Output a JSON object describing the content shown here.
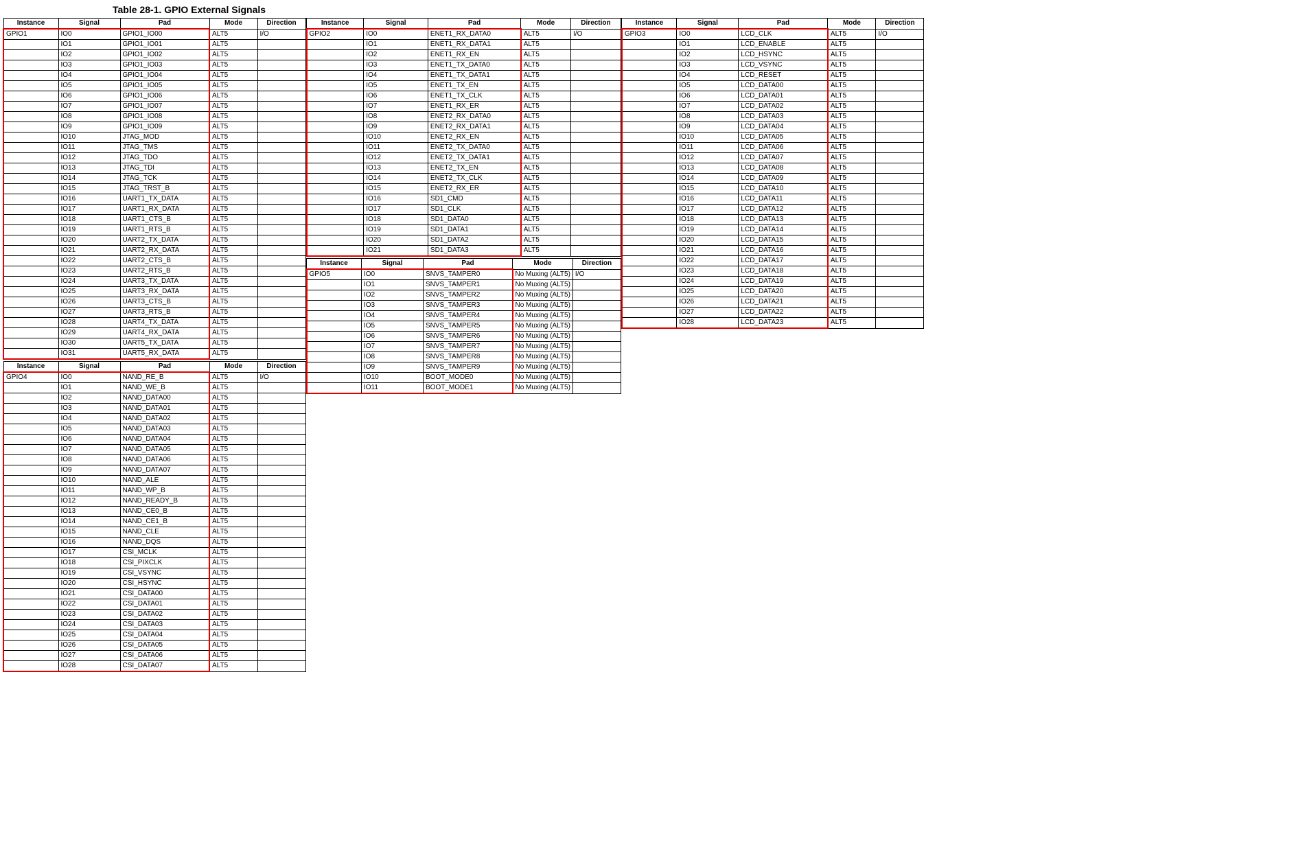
{
  "title": "Table 28-1.  GPIO External Signals",
  "headers": {
    "instance": "Instance",
    "signal": "Signal",
    "pad": "Pad",
    "mode": "Mode",
    "direction": "Direction"
  },
  "chart_data": [
    {
      "type": "table",
      "title": "GPIO1",
      "columns": [
        "Instance",
        "Signal",
        "Pad",
        "Mode",
        "Direction"
      ],
      "rows": [
        [
          "GPIO1",
          "IO0",
          "GPIO1_IO00",
          "ALT5",
          "I/O"
        ],
        [
          "",
          "IO1",
          "GPIO1_IO01",
          "ALT5",
          ""
        ],
        [
          "",
          "IO2",
          "GPIO1_IO02",
          "ALT5",
          ""
        ],
        [
          "",
          "IO3",
          "GPIO1_IO03",
          "ALT5",
          ""
        ],
        [
          "",
          "IO4",
          "GPIO1_IO04",
          "ALT5",
          ""
        ],
        [
          "",
          "IO5",
          "GPIO1_IO05",
          "ALT5",
          ""
        ],
        [
          "",
          "IO6",
          "GPIO1_IO06",
          "ALT5",
          ""
        ],
        [
          "",
          "IO7",
          "GPIO1_IO07",
          "ALT5",
          ""
        ],
        [
          "",
          "IO8",
          "GPIO1_IO08",
          "ALT5",
          ""
        ],
        [
          "",
          "IO9",
          "GPIO1_IO09",
          "ALT5",
          ""
        ],
        [
          "",
          "IO10",
          "JTAG_MOD",
          "ALT5",
          ""
        ],
        [
          "",
          "IO11",
          "JTAG_TMS",
          "ALT5",
          ""
        ],
        [
          "",
          "IO12",
          "JTAG_TDO",
          "ALT5",
          ""
        ],
        [
          "",
          "IO13",
          "JTAG_TDI",
          "ALT5",
          ""
        ],
        [
          "",
          "IO14",
          "JTAG_TCK",
          "ALT5",
          ""
        ],
        [
          "",
          "IO15",
          "JTAG_TRST_B",
          "ALT5",
          ""
        ],
        [
          "",
          "IO16",
          "UART1_TX_DATA",
          "ALT5",
          ""
        ],
        [
          "",
          "IO17",
          "UART1_RX_DATA",
          "ALT5",
          ""
        ],
        [
          "",
          "IO18",
          "UART1_CTS_B",
          "ALT5",
          ""
        ],
        [
          "",
          "IO19",
          "UART1_RTS_B",
          "ALT5",
          ""
        ],
        [
          "",
          "IO20",
          "UART2_TX_DATA",
          "ALT5",
          ""
        ],
        [
          "",
          "IO21",
          "UART2_RX_DATA",
          "ALT5",
          ""
        ],
        [
          "",
          "IO22",
          "UART2_CTS_B",
          "ALT5",
          ""
        ],
        [
          "",
          "IO23",
          "UART2_RTS_B",
          "ALT5",
          ""
        ],
        [
          "",
          "IO24",
          "UART3_TX_DATA",
          "ALT5",
          ""
        ],
        [
          "",
          "IO25",
          "UART3_RX_DATA",
          "ALT5",
          ""
        ],
        [
          "",
          "IO26",
          "UART3_CTS_B",
          "ALT5",
          ""
        ],
        [
          "",
          "IO27",
          "UART3_RTS_B",
          "ALT5",
          ""
        ],
        [
          "",
          "IO28",
          "UART4_TX_DATA",
          "ALT5",
          ""
        ],
        [
          "",
          "IO29",
          "UART4_RX_DATA",
          "ALT5",
          ""
        ],
        [
          "",
          "IO30",
          "UART5_TX_DATA",
          "ALT5",
          ""
        ],
        [
          "",
          "IO31",
          "UART5_RX_DATA",
          "ALT5",
          ""
        ]
      ],
      "highlight": {
        "from": 0,
        "to": 31,
        "cols": [
          0,
          1,
          2
        ]
      }
    },
    {
      "type": "table",
      "title": "GPIO4",
      "columns": [
        "Instance",
        "Signal",
        "Pad",
        "Mode",
        "Direction"
      ],
      "rows": [
        [
          "GPIO4",
          "IO0",
          "NAND_RE_B",
          "ALT5",
          "I/O"
        ],
        [
          "",
          "IO1",
          "NAND_WE_B",
          "ALT5",
          ""
        ],
        [
          "",
          "IO2",
          "NAND_DATA00",
          "ALT5",
          ""
        ],
        [
          "",
          "IO3",
          "NAND_DATA01",
          "ALT5",
          ""
        ],
        [
          "",
          "IO4",
          "NAND_DATA02",
          "ALT5",
          ""
        ],
        [
          "",
          "IO5",
          "NAND_DATA03",
          "ALT5",
          ""
        ],
        [
          "",
          "IO6",
          "NAND_DATA04",
          "ALT5",
          ""
        ],
        [
          "",
          "IO7",
          "NAND_DATA05",
          "ALT5",
          ""
        ],
        [
          "",
          "IO8",
          "NAND_DATA06",
          "ALT5",
          ""
        ],
        [
          "",
          "IO9",
          "NAND_DATA07",
          "ALT5",
          ""
        ],
        [
          "",
          "IO10",
          "NAND_ALE",
          "ALT5",
          ""
        ],
        [
          "",
          "IO11",
          "NAND_WP_B",
          "ALT5",
          ""
        ],
        [
          "",
          "IO12",
          "NAND_READY_B",
          "ALT5",
          ""
        ],
        [
          "",
          "IO13",
          "NAND_CE0_B",
          "ALT5",
          ""
        ],
        [
          "",
          "IO14",
          "NAND_CE1_B",
          "ALT5",
          ""
        ],
        [
          "",
          "IO15",
          "NAND_CLE",
          "ALT5",
          ""
        ],
        [
          "",
          "IO16",
          "NAND_DQS",
          "ALT5",
          ""
        ],
        [
          "",
          "IO17",
          "CSI_MCLK",
          "ALT5",
          ""
        ],
        [
          "",
          "IO18",
          "CSI_PIXCLK",
          "ALT5",
          ""
        ],
        [
          "",
          "IO19",
          "CSI_VSYNC",
          "ALT5",
          ""
        ],
        [
          "",
          "IO20",
          "CSI_HSYNC",
          "ALT5",
          ""
        ],
        [
          "",
          "IO21",
          "CSI_DATA00",
          "ALT5",
          ""
        ],
        [
          "",
          "IO22",
          "CSI_DATA01",
          "ALT5",
          ""
        ],
        [
          "",
          "IO23",
          "CSI_DATA02",
          "ALT5",
          ""
        ],
        [
          "",
          "IO24",
          "CSI_DATA03",
          "ALT5",
          ""
        ],
        [
          "",
          "IO25",
          "CSI_DATA04",
          "ALT5",
          ""
        ],
        [
          "",
          "IO26",
          "CSI_DATA05",
          "ALT5",
          ""
        ],
        [
          "",
          "IO27",
          "CSI_DATA06",
          "ALT5",
          ""
        ],
        [
          "",
          "IO28",
          "CSI_DATA07",
          "ALT5",
          ""
        ]
      ],
      "highlight": {
        "from": 0,
        "to": 28,
        "cols": [
          0,
          1,
          2
        ]
      }
    },
    {
      "type": "table",
      "title": "GPIO2",
      "columns": [
        "Instance",
        "Signal",
        "Pad",
        "Mode",
        "Direction"
      ],
      "rows": [
        [
          "GPIO2",
          "IO0",
          "ENET1_RX_DATA0",
          "ALT5",
          "I/O"
        ],
        [
          "",
          "IO1",
          "ENET1_RX_DATA1",
          "ALT5",
          ""
        ],
        [
          "",
          "IO2",
          "ENET1_RX_EN",
          "ALT5",
          ""
        ],
        [
          "",
          "IO3",
          "ENET1_TX_DATA0",
          "ALT5",
          ""
        ],
        [
          "",
          "IO4",
          "ENET1_TX_DATA1",
          "ALT5",
          ""
        ],
        [
          "",
          "IO5",
          "ENET1_TX_EN",
          "ALT5",
          ""
        ],
        [
          "",
          "IO6",
          "ENET1_TX_CLK",
          "ALT5",
          ""
        ],
        [
          "",
          "IO7",
          "ENET1_RX_ER",
          "ALT5",
          ""
        ],
        [
          "",
          "IO8",
          "ENET2_RX_DATA0",
          "ALT5",
          ""
        ],
        [
          "",
          "IO9",
          "ENET2_RX_DATA1",
          "ALT5",
          ""
        ],
        [
          "",
          "IO10",
          "ENET2_RX_EN",
          "ALT5",
          ""
        ],
        [
          "",
          "IO11",
          "ENET2_TX_DATA0",
          "ALT5",
          ""
        ],
        [
          "",
          "IO12",
          "ENET2_TX_DATA1",
          "ALT5",
          ""
        ],
        [
          "",
          "IO13",
          "ENET2_TX_EN",
          "ALT5",
          ""
        ],
        [
          "",
          "IO14",
          "ENET2_TX_CLK",
          "ALT5",
          ""
        ],
        [
          "",
          "IO15",
          "ENET2_RX_ER",
          "ALT5",
          ""
        ],
        [
          "",
          "IO16",
          "SD1_CMD",
          "ALT5",
          ""
        ],
        [
          "",
          "IO17",
          "SD1_CLK",
          "ALT5",
          ""
        ],
        [
          "",
          "IO18",
          "SD1_DATA0",
          "ALT5",
          ""
        ],
        [
          "",
          "IO19",
          "SD1_DATA1",
          "ALT5",
          ""
        ],
        [
          "",
          "IO20",
          "SD1_DATA2",
          "ALT5",
          ""
        ],
        [
          "",
          "IO21",
          "SD1_DATA3",
          "ALT5",
          ""
        ]
      ],
      "highlight": {
        "from": 0,
        "to": 21,
        "cols": [
          0,
          1,
          2
        ]
      }
    },
    {
      "type": "table",
      "title": "GPIO5",
      "columns": [
        "Instance",
        "Signal",
        "Pad",
        "Mode",
        "Direction"
      ],
      "tall": true,
      "rows": [
        [
          "GPIO5",
          "IO0",
          "SNVS_TAMPER0",
          "No Muxing (ALT5)",
          "I/O"
        ],
        [
          "",
          "IO1",
          "SNVS_TAMPER1",
          "No Muxing (ALT5)",
          ""
        ],
        [
          "",
          "IO2",
          "SNVS_TAMPER2",
          "No Muxing (ALT5)",
          ""
        ],
        [
          "",
          "IO3",
          "SNVS_TAMPER3",
          "No Muxing (ALT5)",
          ""
        ],
        [
          "",
          "IO4",
          "SNVS_TAMPER4",
          "No Muxing (ALT5)",
          ""
        ],
        [
          "",
          "IO5",
          "SNVS_TAMPER5",
          "No Muxing (ALT5)",
          ""
        ],
        [
          "",
          "IO6",
          "SNVS_TAMPER6",
          "No Muxing (ALT5)",
          ""
        ],
        [
          "",
          "IO7",
          "SNVS_TAMPER7",
          "No Muxing (ALT5)",
          ""
        ],
        [
          "",
          "IO8",
          "SNVS_TAMPER8",
          "No Muxing (ALT5)",
          ""
        ],
        [
          "",
          "IO9",
          "SNVS_TAMPER9",
          "No Muxing (ALT5)",
          ""
        ],
        [
          "",
          "IO10",
          "BOOT_MODE0",
          "No Muxing (ALT5)",
          ""
        ],
        [
          "",
          "IO11",
          "BOOT_MODE1",
          "No Muxing (ALT5)",
          ""
        ]
      ],
      "highlight": {
        "from": 0,
        "to": 11,
        "cols": [
          0,
          1,
          2
        ]
      }
    },
    {
      "type": "table",
      "title": "GPIO3",
      "columns": [
        "Instance",
        "Signal",
        "Pad",
        "Mode",
        "Direction"
      ],
      "rows": [
        [
          "GPIO3",
          "IO0",
          "LCD_CLK",
          "ALT5",
          "I/O"
        ],
        [
          "",
          "IO1",
          "LCD_ENABLE",
          "ALT5",
          ""
        ],
        [
          "",
          "IO2",
          "LCD_HSYNC",
          "ALT5",
          ""
        ],
        [
          "",
          "IO3",
          "LCD_VSYNC",
          "ALT5",
          ""
        ],
        [
          "",
          "IO4",
          "LCD_RESET",
          "ALT5",
          ""
        ],
        [
          "",
          "IO5",
          "LCD_DATA00",
          "ALT5",
          ""
        ],
        [
          "",
          "IO6",
          "LCD_DATA01",
          "ALT5",
          ""
        ],
        [
          "",
          "IO7",
          "LCD_DATA02",
          "ALT5",
          ""
        ],
        [
          "",
          "IO8",
          "LCD_DATA03",
          "ALT5",
          ""
        ],
        [
          "",
          "IO9",
          "LCD_DATA04",
          "ALT5",
          ""
        ],
        [
          "",
          "IO10",
          "LCD_DATA05",
          "ALT5",
          ""
        ],
        [
          "",
          "IO11",
          "LCD_DATA06",
          "ALT5",
          ""
        ],
        [
          "",
          "IO12",
          "LCD_DATA07",
          "ALT5",
          ""
        ],
        [
          "",
          "IO13",
          "LCD_DATA08",
          "ALT5",
          ""
        ],
        [
          "",
          "IO14",
          "LCD_DATA09",
          "ALT5",
          ""
        ],
        [
          "",
          "IO15",
          "LCD_DATA10",
          "ALT5",
          ""
        ],
        [
          "",
          "IO16",
          "LCD_DATA11",
          "ALT5",
          ""
        ],
        [
          "",
          "IO17",
          "LCD_DATA12",
          "ALT5",
          ""
        ],
        [
          "",
          "IO18",
          "LCD_DATA13",
          "ALT5",
          ""
        ],
        [
          "",
          "IO19",
          "LCD_DATA14",
          "ALT5",
          ""
        ],
        [
          "",
          "IO20",
          "LCD_DATA15",
          "ALT5",
          ""
        ],
        [
          "",
          "IO21",
          "LCD_DATA16",
          "ALT5",
          ""
        ],
        [
          "",
          "IO22",
          "LCD_DATA17",
          "ALT5",
          ""
        ],
        [
          "",
          "IO23",
          "LCD_DATA18",
          "ALT5",
          ""
        ],
        [
          "",
          "IO24",
          "LCD_DATA19",
          "ALT5",
          ""
        ],
        [
          "",
          "IO25",
          "LCD_DATA20",
          "ALT5",
          ""
        ],
        [
          "",
          "IO26",
          "LCD_DATA21",
          "ALT5",
          ""
        ],
        [
          "",
          "IO27",
          "LCD_DATA22",
          "ALT5",
          ""
        ],
        [
          "",
          "IO28",
          "LCD_DATA23",
          "ALT5",
          ""
        ]
      ],
      "highlight": {
        "from": 0,
        "to": 28,
        "cols": [
          0,
          1,
          2
        ]
      }
    }
  ],
  "layout": {
    "col1": [
      0,
      1
    ],
    "col2": [
      2,
      3
    ],
    "col3": [
      4
    ]
  }
}
